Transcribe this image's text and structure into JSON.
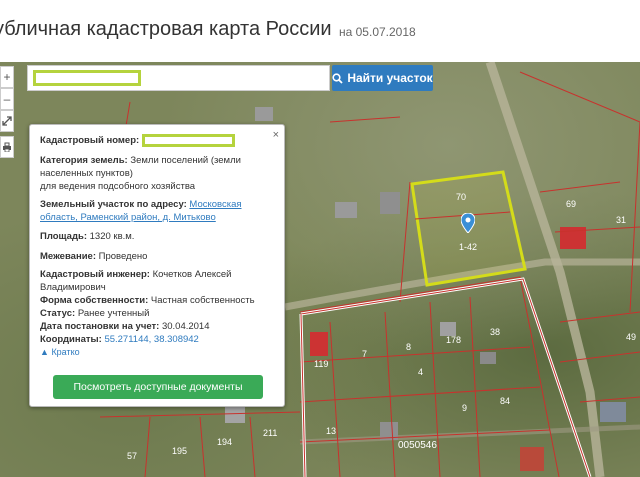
{
  "header": {
    "title": "убличная кадастровая карта России",
    "date": "на 05.07.2018"
  },
  "controls": {
    "zoom_in": "+",
    "zoom_out": "–"
  },
  "search": {
    "value": "",
    "button_label": "Найти участок"
  },
  "card": {
    "close": "×",
    "cadastral_number_label": "Кадастровый номер:",
    "land_category_label": "Категория земель:",
    "land_category_value": "Земли поселений (земли населенных пунктов)",
    "land_use_value": "для ведения подсобного хозяйства",
    "address_label": "Земельный участок по адресу:",
    "address_value": "Московская область, Раменский район, д. Митьково",
    "area_label": "Площадь:",
    "area_value": "1320 кв.м.",
    "survey_label": "Межевание:",
    "survey_value": "Проведено",
    "engineer_label": "Кадастровый инженер:",
    "engineer_value": "Кочетков Алексей Владимирович",
    "ownership_label": "Форма собственности:",
    "ownership_value": "Частная собственность",
    "status_label": "Статус:",
    "status_value": "Ранее учтенный",
    "registration_label": "Дата постановки на учет:",
    "registration_value": "30.04.2014",
    "coords_label": "Координаты:",
    "coords_value": "55.271144, 38.308942",
    "brief_label": "Кратко",
    "docs_button": "Посмотреть доступные документы"
  },
  "map": {
    "parcel_labels": [
      "70",
      "1-42",
      "69",
      "31",
      "38",
      "178",
      "8",
      "7",
      "119",
      "4",
      "84",
      "9",
      "13",
      "211",
      "194",
      "195",
      "57",
      "49"
    ],
    "cadastral_code": "0050546",
    "colors": {
      "selected_parcel": "#d4dc1a",
      "parcel_border": "#c8322d",
      "boundary": "#ffffff",
      "button_blue": "#2f7bbf",
      "button_green": "#3aaa57",
      "highlight": "#b5d33d"
    }
  }
}
